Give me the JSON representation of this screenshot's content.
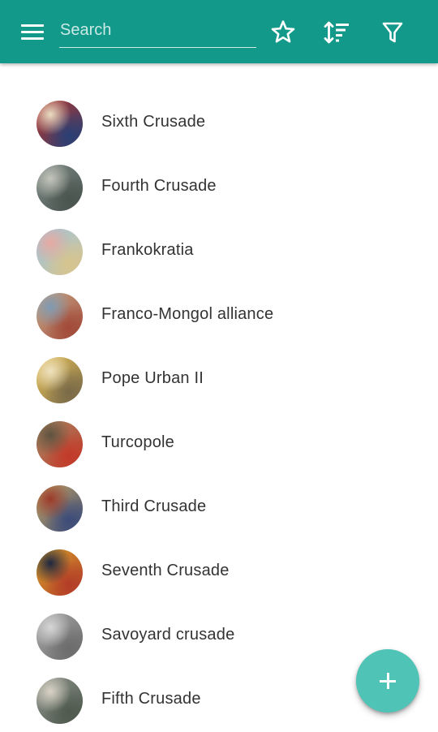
{
  "appbar": {
    "search_placeholder": "Search",
    "search_value": "",
    "color": "#13998a",
    "icons": {
      "menu": "menu-icon",
      "favorites": "star-icon",
      "sort": "sort-icon",
      "filter": "filter-icon"
    }
  },
  "list": {
    "items": [
      {
        "label": "Sixth Crusade",
        "thumb_colors": [
          "#b8352a",
          "#e9dcc3",
          "#2a3f74"
        ]
      },
      {
        "label": "Fourth Crusade",
        "thumb_colors": [
          "#7d8a86",
          "#c4c5bb",
          "#4a544f"
        ]
      },
      {
        "label": "Frankokratia",
        "thumb_colors": [
          "#9cc4e0",
          "#e7a9a1",
          "#d7c48e"
        ]
      },
      {
        "label": "Franco-Mongol alliance",
        "thumb_colors": [
          "#c7ad8b",
          "#7f9ab3",
          "#a24a3a"
        ]
      },
      {
        "label": "Pope Urban II",
        "thumb_colors": [
          "#e8c35a",
          "#efe2c1",
          "#7a6a48"
        ]
      },
      {
        "label": "Turcopole",
        "thumb_colors": [
          "#a38b67",
          "#5f5340",
          "#c33a29"
        ]
      },
      {
        "label": "Third Crusade",
        "thumb_colors": [
          "#c9a862",
          "#9c3a2b",
          "#3b4b79"
        ]
      },
      {
        "label": "Seventh Crusade",
        "thumb_colors": [
          "#d9a52b",
          "#1e2740",
          "#b33d28"
        ]
      },
      {
        "label": "Savoyard crusade",
        "thumb_colors": [
          "#a8a8a8",
          "#d6d6d6",
          "#6c6c6c"
        ]
      },
      {
        "label": "Fifth Crusade",
        "thumb_colors": [
          "#8f948c",
          "#d9d3c6",
          "#4f5a4e"
        ]
      }
    ]
  },
  "fab": {
    "icon": "plus-icon",
    "color": "#4ec3b6"
  }
}
